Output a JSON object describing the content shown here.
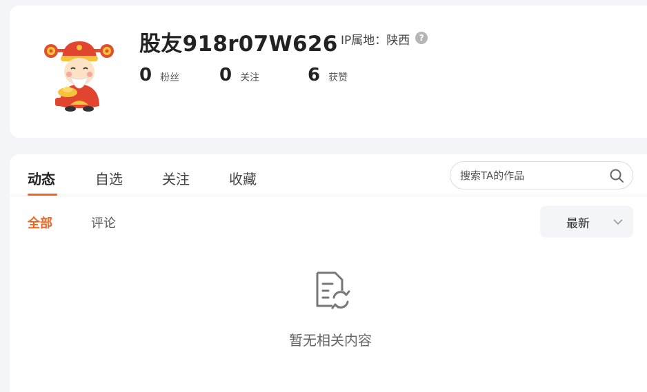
{
  "profile": {
    "username": "股友918r07W626",
    "ip_label": "IP属地：陕西",
    "stats": [
      {
        "value": "0",
        "label": "粉丝"
      },
      {
        "value": "0",
        "label": "关注"
      },
      {
        "value": "6",
        "label": "获赞"
      }
    ]
  },
  "tabs": [
    {
      "label": "动态",
      "active": true
    },
    {
      "label": "自选",
      "active": false
    },
    {
      "label": "关注",
      "active": false
    },
    {
      "label": "收藏",
      "active": false
    }
  ],
  "search": {
    "placeholder": "搜索TA的作品"
  },
  "subtabs": [
    {
      "label": "全部",
      "active": true
    },
    {
      "label": "评论",
      "active": false
    }
  ],
  "sort": {
    "selected": "最新"
  },
  "empty_state": {
    "text": "暂无相关内容"
  },
  "colors": {
    "accent": "#f0641e",
    "background": "#f4f5f7"
  }
}
